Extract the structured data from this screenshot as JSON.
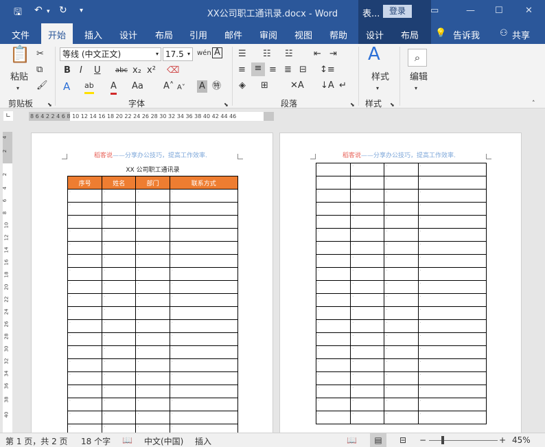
{
  "window": {
    "title": "XX公司职工通讯录.docx  -  Word",
    "context_tab": "表...",
    "login": "登录"
  },
  "tabs": [
    "文件",
    "开始",
    "插入",
    "设计",
    "布局",
    "引用",
    "邮件",
    "审阅",
    "视图",
    "帮助",
    "设计",
    "布局",
    "告诉我",
    "共享"
  ],
  "ribbon": {
    "clipboard": {
      "paste": "粘贴",
      "label": "剪贴板"
    },
    "font": {
      "name": "等线 (中文正文)",
      "size": "17.5",
      "label": "字体"
    },
    "paragraph": {
      "label": "段落"
    },
    "styles": {
      "btn": "样式",
      "label": "样式"
    },
    "edit": {
      "btn": "编辑"
    }
  },
  "ruler": {
    "h": "8  6  4  2        2  4  6    8  10 12 14    16 18 20 22 24 26 28 30 32 34 36 38    40 42 44 46",
    "v": [
      "4",
      "2",
      "2",
      "4",
      "6",
      "8",
      "10",
      "12",
      "14",
      "16",
      "18",
      "20",
      "22",
      "24",
      "26",
      "28",
      "30",
      "32",
      "34",
      "36",
      "38",
      "40"
    ]
  },
  "document": {
    "header_a": "稻客说",
    "header_b": "——分享办公技巧，提高工作效率.",
    "table_title": "XX 公司职工通讯录",
    "columns": [
      "序号",
      "姓名",
      "部门",
      "联系方式"
    ]
  },
  "status": {
    "page": "第 1 页，共 2 页",
    "words": "18 个字",
    "lang": "中文(中国)",
    "mode": "插入",
    "zoom": "45%"
  }
}
